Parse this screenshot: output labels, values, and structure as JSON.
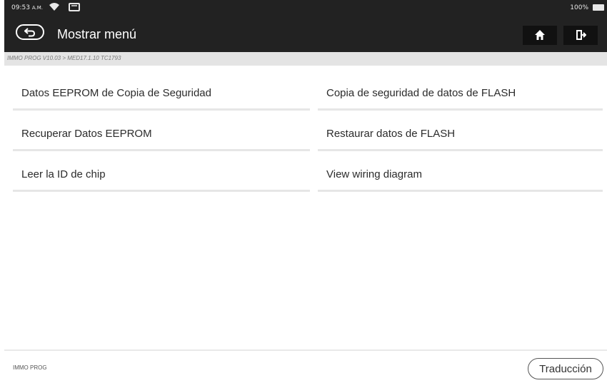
{
  "status_bar": {
    "time": "09:53",
    "ampm": "A.M.",
    "battery": "100%"
  },
  "header": {
    "title": "Mostrar menú",
    "back_icon": "back-arrow-icon",
    "home_icon": "home-icon",
    "exit_icon": "exit-icon"
  },
  "breadcrumb": "IMMO PROG V10.03 > MED17.1.10 TC1793",
  "menu": {
    "items": [
      "Datos EEPROM de Copia de Seguridad",
      "Copia de seguridad de datos de FLASH",
      "Recuperar Datos EEPROM",
      "Restaurar datos de FLASH",
      "Leer la ID de chip",
      "View wiring diagram"
    ]
  },
  "footer": {
    "label": "IMMO PROG",
    "translate_button": "Traducción"
  },
  "colors": {
    "header_bg": "#222222",
    "breadcrumb_bg": "#e4e4e4",
    "divider": "#e6e6e6"
  }
}
